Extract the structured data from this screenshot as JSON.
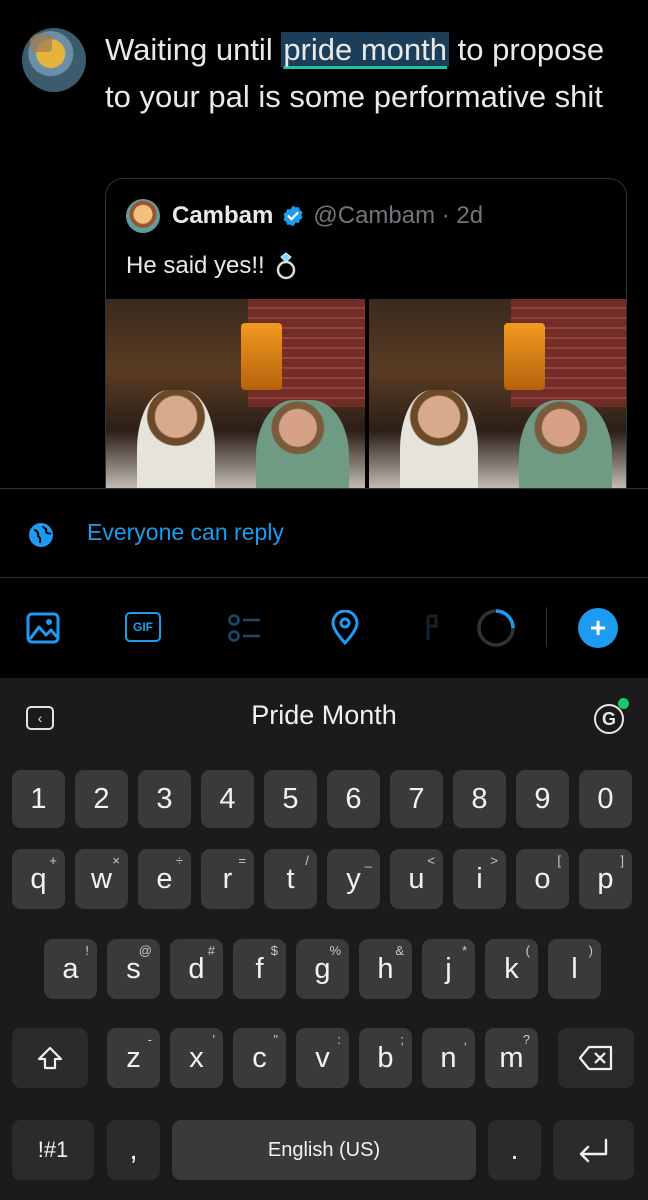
{
  "compose": {
    "text_before": "Waiting until ",
    "text_highlight": "pride month",
    "text_after": " to propose to your pal is some performative shit"
  },
  "quote": {
    "name": "Cambam",
    "handle": "@Cambam · 2d",
    "text": "He said yes!!"
  },
  "reply_setting": "Everyone can reply",
  "toolbar": {
    "gif_label": "GIF",
    "plus_label": "+"
  },
  "keyboard": {
    "suggestion": "Pride Month",
    "grammarly_label": "G",
    "numbers": [
      "1",
      "2",
      "3",
      "4",
      "5",
      "6",
      "7",
      "8",
      "9",
      "0"
    ],
    "row1": [
      {
        "k": "q",
        "s": "+"
      },
      {
        "k": "w",
        "s": "×"
      },
      {
        "k": "e",
        "s": "÷"
      },
      {
        "k": "r",
        "s": "="
      },
      {
        "k": "t",
        "s": "/"
      },
      {
        "k": "y",
        "s": "_"
      },
      {
        "k": "u",
        "s": "<"
      },
      {
        "k": "i",
        "s": ">"
      },
      {
        "k": "o",
        "s": "["
      },
      {
        "k": "p",
        "s": "]"
      }
    ],
    "row2": [
      {
        "k": "a",
        "s": "!"
      },
      {
        "k": "s",
        "s": "@"
      },
      {
        "k": "d",
        "s": "#"
      },
      {
        "k": "f",
        "s": "$"
      },
      {
        "k": "g",
        "s": "%"
      },
      {
        "k": "h",
        "s": "&"
      },
      {
        "k": "j",
        "s": "*"
      },
      {
        "k": "k",
        "s": "("
      },
      {
        "k": "l",
        "s": ")"
      }
    ],
    "row3": [
      {
        "k": "z",
        "s": "-"
      },
      {
        "k": "x",
        "s": "'"
      },
      {
        "k": "c",
        "s": "\""
      },
      {
        "k": "v",
        "s": ":"
      },
      {
        "k": "b",
        "s": ";"
      },
      {
        "k": "n",
        "s": ","
      },
      {
        "k": "m",
        "s": "?"
      }
    ],
    "symbols_key": "!#1",
    "comma_key": ",",
    "space_key": "English (US)",
    "period_key": "."
  }
}
